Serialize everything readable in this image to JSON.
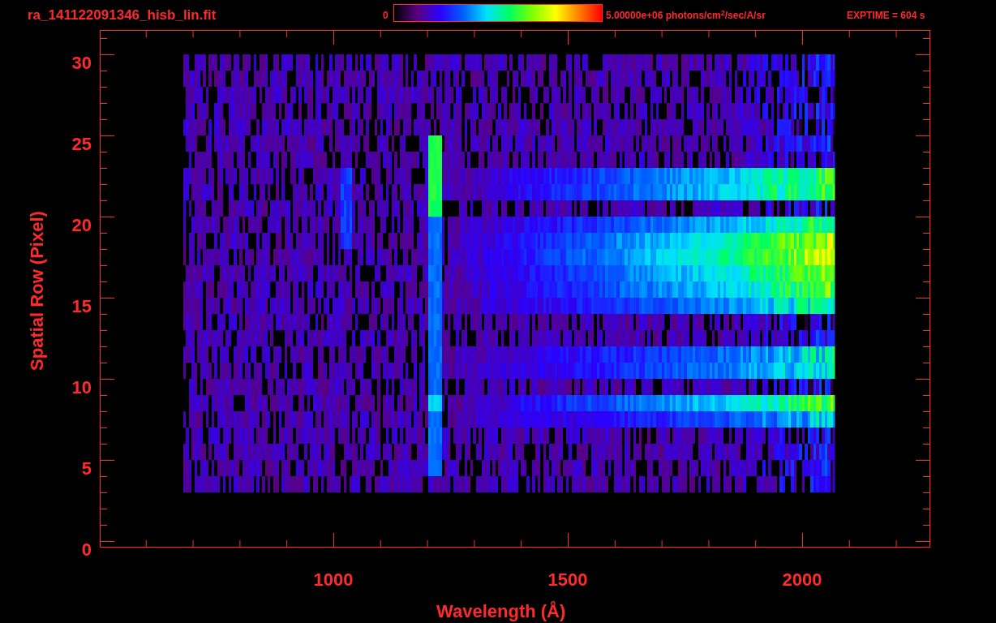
{
  "title": "ra_141122091346_hisb_lin.fit",
  "colorbar": {
    "min_label": "0",
    "max_label": "5.00000e+06 photons/cm$^{2}$/sec/A/sr"
  },
  "exposure": "EXPTIME = 604 s",
  "x_axis": {
    "label": "Wavelength (Å)",
    "ticks": [
      "1000",
      "1500",
      "2000"
    ]
  },
  "y_axis": {
    "label": "Spatial Row (Pixel)",
    "ticks": [
      "30",
      "25",
      "20",
      "15",
      "10",
      "5",
      "0"
    ]
  }
}
